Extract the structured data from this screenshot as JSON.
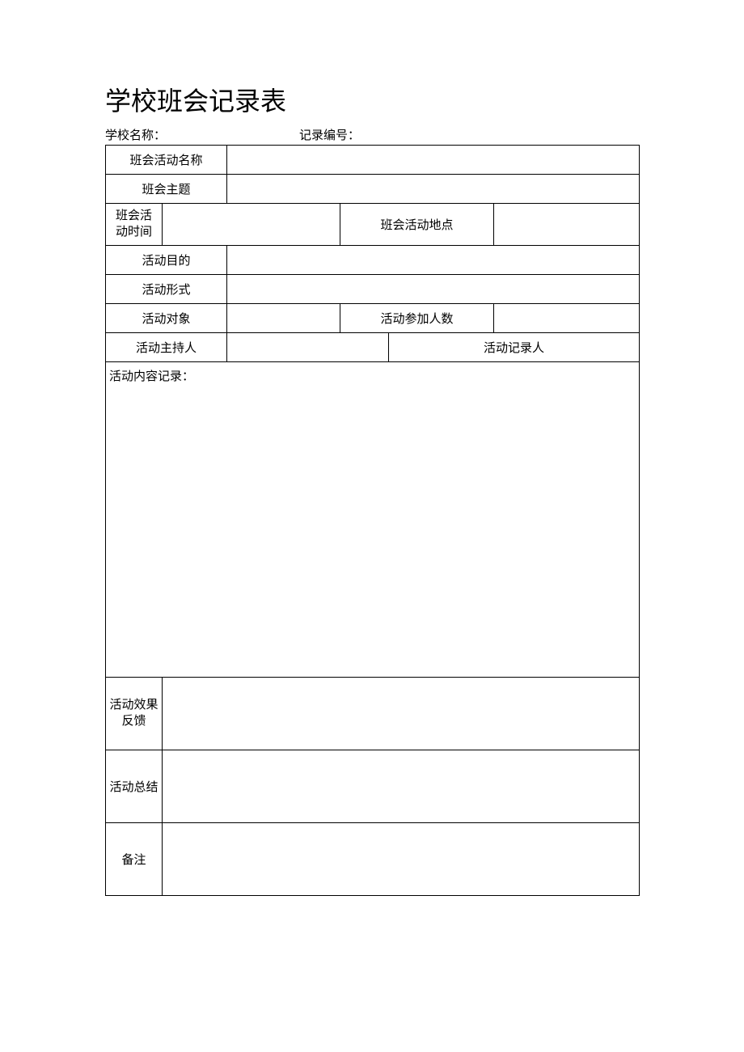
{
  "title": "学校班会记录表",
  "header": {
    "school_name_label": "学校名称：",
    "school_name_value": "",
    "record_number_label": "记录编号：",
    "record_number_value": ""
  },
  "rows": {
    "activity_name": {
      "label": "班会活动名称",
      "value": ""
    },
    "theme": {
      "label": "班会主题",
      "value": ""
    },
    "time": {
      "label_line1": "班会活",
      "label_line2": "动时间",
      "value": ""
    },
    "location": {
      "label": "班会活动地点",
      "value": ""
    },
    "purpose": {
      "label": "活动目的",
      "value": ""
    },
    "format": {
      "label": "活动形式",
      "value": ""
    },
    "target": {
      "label": "活动对象",
      "value": ""
    },
    "participants": {
      "label": "活动参加人数",
      "value": ""
    },
    "host": {
      "label": "活动主持人",
      "value": ""
    },
    "recorder": {
      "label": "活动记录人",
      "value": ""
    },
    "content": {
      "label": "活动内容记录：",
      "value": ""
    },
    "feedback": {
      "label_line1": "活动效果",
      "label_line2": "反馈",
      "value": ""
    },
    "summary": {
      "label": "活动总结",
      "value": ""
    },
    "notes": {
      "label": "备注",
      "value": ""
    }
  }
}
